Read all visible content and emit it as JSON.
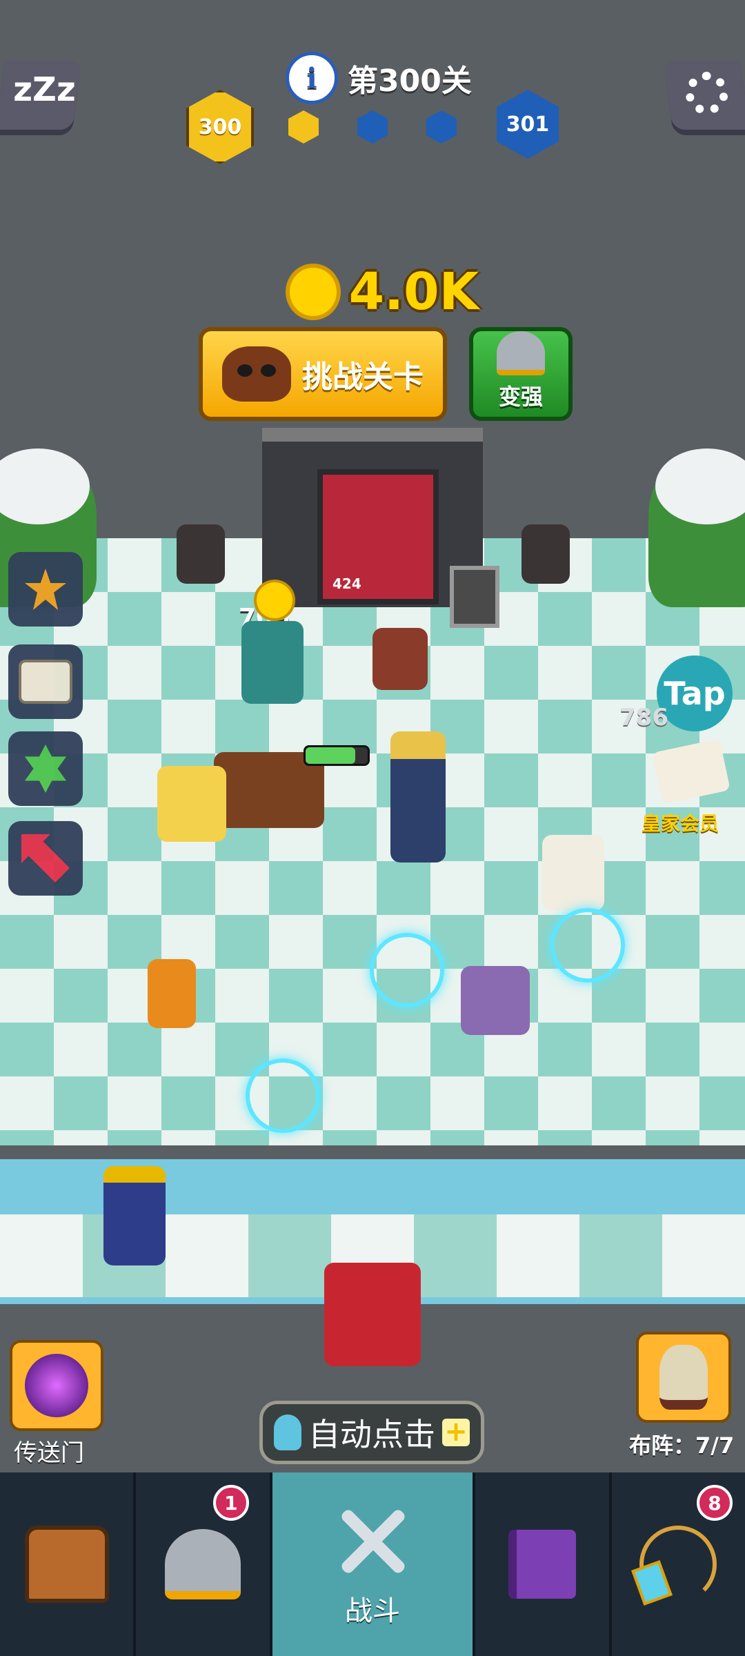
{
  "header": {
    "level_title": "第300关",
    "current_level_badge": "300",
    "next_level_badge": "301",
    "progress_pips": [
      {
        "color": "#f3c21b",
        "state": "done"
      },
      {
        "color": "#1f5fb8",
        "state": "pending"
      },
      {
        "color": "#1f5fb8",
        "state": "pending"
      }
    ],
    "sleep_icon": "zzz-icon",
    "settings_icon": "gear-icon"
  },
  "hud": {
    "gold_amount": "4.0K",
    "challenge_label": "挑战关卡",
    "strengthen_label": "变强",
    "tap_label": "Tap",
    "royal_label": "皇家会员",
    "coin_drop_1": "709",
    "coin_drop_2": "786",
    "door_number": "424"
  },
  "side_menu": [
    {
      "icon": "trophy-icon"
    },
    {
      "icon": "scroll-icon"
    },
    {
      "icon": "hexagram-icon"
    },
    {
      "icon": "arrow-icon"
    }
  ],
  "actions": {
    "portal_label": "传送门",
    "auto_tap_label": "自动点击",
    "formation_label": "布阵：",
    "formation_count": "7/7"
  },
  "nav": {
    "items": [
      {
        "icon": "chest-icon",
        "label": "",
        "badge": ""
      },
      {
        "icon": "viking-helmet-icon",
        "label": "",
        "badge": "1"
      },
      {
        "icon": "crossed-swords-icon",
        "label": "战斗",
        "badge": ""
      },
      {
        "icon": "spellbook-icon",
        "label": "",
        "badge": ""
      },
      {
        "icon": "necklace-icon",
        "label": "",
        "badge": "8"
      }
    ]
  },
  "colors": {
    "accent_gold": "#ffd400",
    "accent_blue": "#1f5fb8",
    "active_tab": "#4fa3ab",
    "badge_red": "#d22a5a"
  }
}
